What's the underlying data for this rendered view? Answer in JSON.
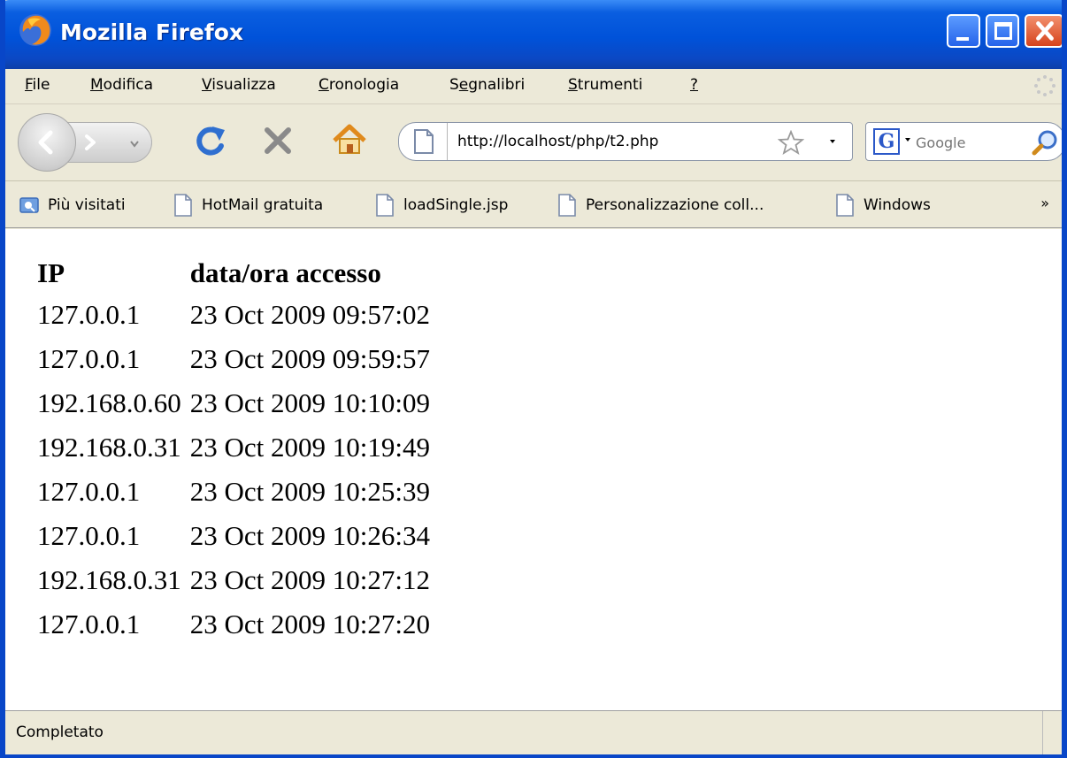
{
  "window": {
    "title": "Mozilla Firefox",
    "title_bar_color": "#0052d9"
  },
  "menu": {
    "items": [
      {
        "mnemonic": "F",
        "rest": "ile"
      },
      {
        "mnemonic": "M",
        "rest": "odifica"
      },
      {
        "mnemonic": "V",
        "rest": "isualizza"
      },
      {
        "mnemonic": "C",
        "rest": "ronologia"
      },
      {
        "prefix": "S",
        "mnemonic": "e",
        "rest": "gnalibri"
      },
      {
        "mnemonic": "S",
        "rest": "trumenti"
      },
      {
        "mnemonic": "?",
        "rest": ""
      }
    ]
  },
  "navigation": {
    "url": "http://localhost/php/t2.php",
    "search_placeholder": "Google",
    "icons": [
      "back-icon",
      "forward-icon",
      "history-dropdown-icon",
      "reload-icon",
      "stop-icon",
      "home-icon",
      "page-icon",
      "bookmark-star-icon",
      "google-icon",
      "magnify-icon"
    ]
  },
  "bookmarks": {
    "items": [
      {
        "label": "Più visitati",
        "icon": "smart-folder-icon"
      },
      {
        "label": "HotMail gratuita",
        "icon": "page-icon"
      },
      {
        "label": "loadSingle.jsp",
        "icon": "page-icon"
      },
      {
        "label": "Personalizzazione coll...",
        "icon": "page-icon"
      },
      {
        "label": "Windows",
        "icon": "page-icon"
      }
    ],
    "overflow": "»"
  },
  "content": {
    "columns": [
      "IP",
      "data/ora accesso"
    ],
    "rows": [
      [
        "127.0.0.1",
        "23 Oct 2009 09:57:02"
      ],
      [
        "127.0.0.1",
        "23 Oct 2009 09:59:57"
      ],
      [
        "192.168.0.60",
        "23 Oct 2009 10:10:09"
      ],
      [
        "192.168.0.31",
        "23 Oct 2009 10:19:49"
      ],
      [
        "127.0.0.1",
        "23 Oct 2009 10:25:39"
      ],
      [
        "127.0.0.1",
        "23 Oct 2009 10:26:34"
      ],
      [
        "192.168.0.31",
        "23 Oct 2009 10:27:12"
      ],
      [
        "127.0.0.1",
        "23 Oct 2009 10:27:20"
      ]
    ]
  },
  "status": {
    "text": "Completato"
  }
}
